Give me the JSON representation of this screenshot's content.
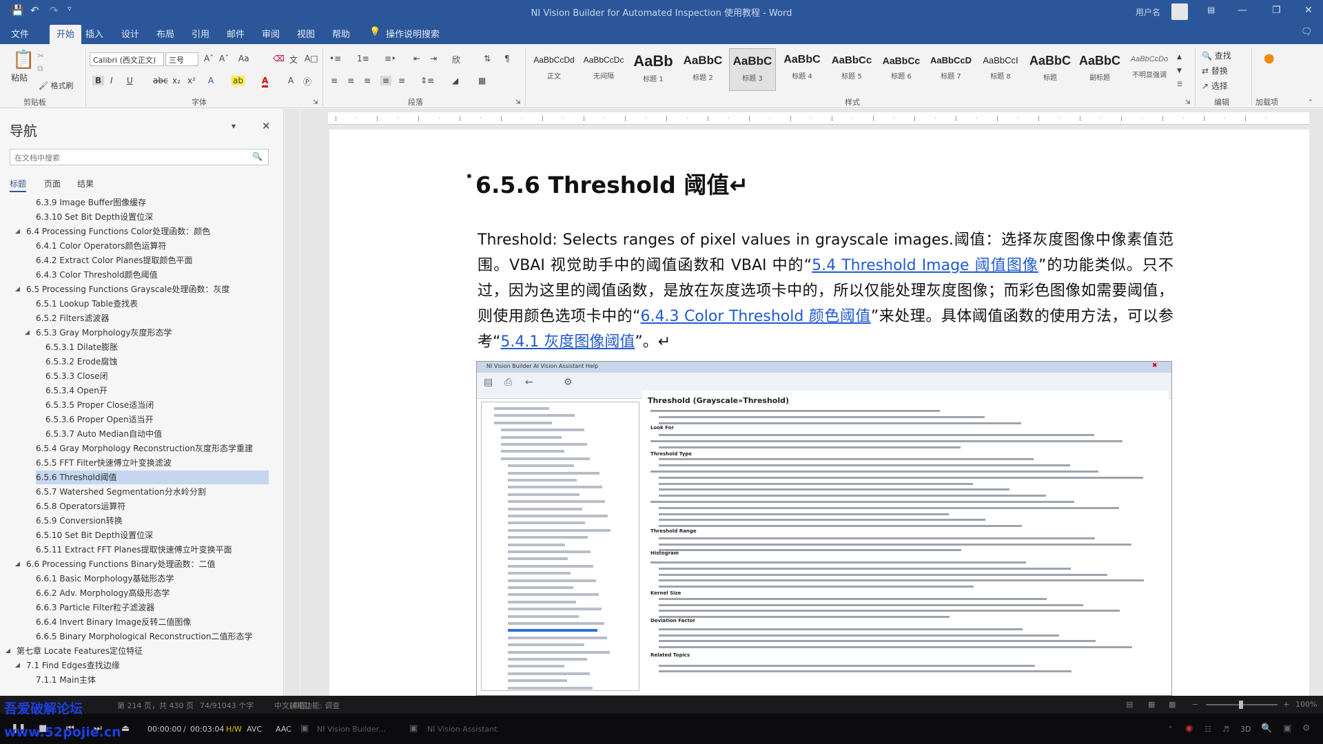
{
  "titlebar": {
    "doc_title": "NI Vision Builder for Automated Inspection 使用教程 - Word",
    "user": "用户名",
    "minimize": "—",
    "restore": "❐",
    "close": "✕"
  },
  "tabs": [
    "文件",
    "开始",
    "插入",
    "设计",
    "布局",
    "引用",
    "邮件",
    "审阅",
    "视图",
    "帮助",
    "操作说明搜索"
  ],
  "ribbon": {
    "clipboard": {
      "paste": "粘贴",
      "format_painter": "格式刷",
      "label": "剪贴板"
    },
    "font": {
      "name": "Calibri (西文正文)",
      "size": "三号",
      "label": "字体",
      "bold": "B",
      "italic": "I",
      "underline": "U"
    },
    "paragraph": {
      "label": "段落"
    },
    "styles": {
      "label": "样式",
      "items": [
        {
          "sample": "AaBbCcDd",
          "name": "正文"
        },
        {
          "sample": "AaBbCcDc",
          "name": "无间隔"
        },
        {
          "sample": "AaBb",
          "name": "标题 1"
        },
        {
          "sample": "AaBbC",
          "name": "标题 2"
        },
        {
          "sample": "AaBbC",
          "name": "标题 3"
        },
        {
          "sample": "AaBbC",
          "name": "标题 4"
        },
        {
          "sample": "AaBbCc",
          "name": "标题 5"
        },
        {
          "sample": "AaBbCc",
          "name": "标题 6"
        },
        {
          "sample": "AaBbCcD",
          "name": "标题 7"
        },
        {
          "sample": "AaBbCcI",
          "name": "标题 8"
        },
        {
          "sample": "AaBbC",
          "name": "标题"
        },
        {
          "sample": "AaBbC",
          "name": "副标题"
        },
        {
          "sample": "AaBbCcDo",
          "name": "不明显强调"
        }
      ]
    },
    "editing": {
      "find": "查找",
      "replace": "替换",
      "select": "选择",
      "label": "编辑"
    },
    "addins": {
      "label": "加载项"
    }
  },
  "nav": {
    "title": "导航",
    "search_placeholder": "在文档中搜索",
    "tabs": [
      "标题",
      "页面",
      "结果"
    ],
    "items": [
      {
        "text": "6.3.9 Image Buffer图像缓存"
      },
      {
        "text": "6.3.10 Set Bit Depth设置位深"
      },
      {
        "text": "6.4 Processing Functions Color处理函数：颜色"
      },
      {
        "text": "6.4.1 Color Operators颜色运算符"
      },
      {
        "text": "6.4.2 Extract Color Planes提取颜色平面"
      },
      {
        "text": "6.4.3 Color Threshold颜色阈值"
      },
      {
        "text": "6.5 Processing Functions Grayscale处理函数：灰度"
      },
      {
        "text": "6.5.1 Lookup Table查找表"
      },
      {
        "text": "6.5.2 Filters滤波器"
      },
      {
        "text": "6.5.3 Gray Morphology灰度形态学"
      },
      {
        "text": "6.5.3.1 Dilate膨胀"
      },
      {
        "text": "6.5.3.2 Erode腐蚀"
      },
      {
        "text": "6.5.3.3 Close闭"
      },
      {
        "text": "6.5.3.4 Open开"
      },
      {
        "text": "6.5.3.5 Proper Close适当闭"
      },
      {
        "text": "6.5.3.6 Proper Open适当开"
      },
      {
        "text": "6.5.3.7 Auto Median自动中值"
      },
      {
        "text": "6.5.4 Gray Morphology Reconstruction灰度形态学重建"
      },
      {
        "text": "6.5.5 FFT Filter快速傅立叶变换滤波"
      },
      {
        "text": "6.5.6 Threshold阈值"
      },
      {
        "text": "6.5.7 Watershed Segmentation分水岭分割"
      },
      {
        "text": "6.5.8 Operators运算符"
      },
      {
        "text": "6.5.9 Conversion转换"
      },
      {
        "text": "6.5.10 Set Bit Depth设置位深"
      },
      {
        "text": "6.5.11 Extract FFT Planes提取快速傅立叶变换平面"
      },
      {
        "text": "6.6 Processing Functions Binary处理函数：二值"
      },
      {
        "text": "6.6.1 Basic Morphology基础形态学"
      },
      {
        "text": "6.6.2 Adv. Morphology高级形态学"
      },
      {
        "text": "6.6.3 Particle Filter粒子滤波器"
      },
      {
        "text": "6.6.4 Invert Binary Image反转二值图像"
      },
      {
        "text": "6.6.5 Binary Morphological Reconstruction二值形态学"
      },
      {
        "text": "第七章 Locate Features定位特征"
      },
      {
        "text": "7.1 Find Edges查找边缘"
      },
      {
        "text": "7.1.1 Main主体"
      }
    ]
  },
  "document": {
    "heading": "6.5.6 Threshold 阈值↵",
    "para": {
      "p1": "Threshold: Selects ranges of pixel values in grayscale images.阈值：选择灰度图像中像素值范围。VBAI 视觉助手中的阈值函数和 VBAI 中的“",
      "link1": "5.4 Threshold Image 阈值图像",
      "p2": "”的功能类似。只不过，因为这里的阈值函数，是放在灰度选项卡中的，所以仅能处理灰度图像；而彩色图像如需要阈值，则使用颜色选项卡中的“",
      "link2": "6.4.3 Color Threshold 颜色阈值",
      "p3": "”来处理。具体阈值函数的使用方法，可以参考“",
      "link3": "5.4.1  灰度图像阈值",
      "p4": "”。↵"
    },
    "embedded": {
      "window_title": "NI Vision Builder AI Vision Assistant Help",
      "help_title": "Threshold (Grayscale»Threshold)",
      "sections": [
        "Look For",
        "Threshold Type",
        "Threshold Range",
        "Histogram",
        "Kernel Size",
        "Deviation Factor",
        "Related Topics"
      ]
    }
  },
  "status": {
    "page": "第 214 页，共 430 页",
    "words": "74/91043 个字",
    "lang": "中文(中国)",
    "assist": "辅助功能: 调查",
    "zoom": "100%"
  },
  "player": {
    "time": "00:00:00",
    "total": "00:03:04",
    "codec": "H/W",
    "video": "AVC",
    "audio": "AAC",
    "task1": "NI Vision Builder...",
    "task2": "NI Vision Assistant",
    "clock": "3D"
  },
  "watermark": {
    "line1": "吾爱破解论坛",
    "line2": "www.52pojie.cn"
  }
}
